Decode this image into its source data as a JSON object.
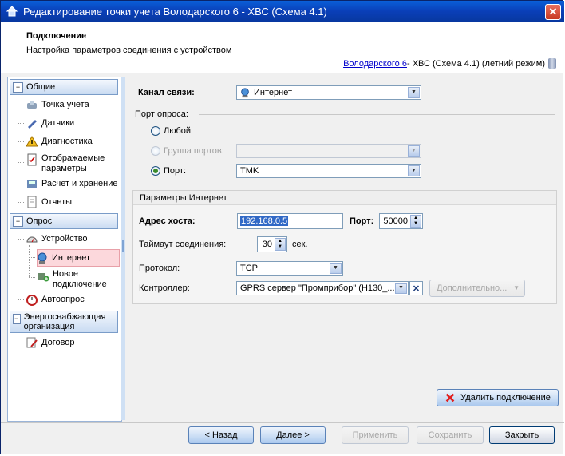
{
  "window": {
    "title": "Редактирование точки учета Володарского 6 - ХВС (Схема 4.1)",
    "close_glyph": "✕"
  },
  "header": {
    "title": "Подключение",
    "subtitle": "Настройка параметров соединения с устройством",
    "path_link": "Володарского 6",
    "path_rest": " - ХВС (Схема 4.1) (летний режим)"
  },
  "nav": {
    "groups": {
      "general": "Общие",
      "poll": "Опрос",
      "energy": "Энергоснабжающая организация"
    },
    "items": {
      "point": "Точка учета",
      "sensors": "Датчики",
      "diagnostics": "Диагностика",
      "displayed_params": "Отображаемые параметры",
      "calc_storage": "Расчет и хранение",
      "reports": "Отчеты",
      "device": "Устройство",
      "internet": "Интернет",
      "new_connection": "Новое подключение",
      "autopoll": "Автоопрос",
      "contract": "Договор"
    }
  },
  "form": {
    "channel_label": "Канал связи:",
    "channel_value": "Интернет",
    "poll_port_label": "Порт опроса:",
    "radio_any": "Любой",
    "radio_group": "Группа портов:",
    "radio_port": "Порт:",
    "port_value": "TMK",
    "panel_title": "Параметры Интернет",
    "host_label": "Адрес хоста:",
    "host_value": "192.168.0.5",
    "port_label": "Порт:",
    "port_num": "50000",
    "timeout_label": "Таймаут соединения:",
    "timeout_value": "30",
    "timeout_unit": "сек.",
    "protocol_label": "Протокол:",
    "protocol_value": "TCP",
    "controller_label": "Контроллер:",
    "controller_value": "GPRS сервер \"Промприбор\" (H130_...",
    "additional_button": "Дополнительно...",
    "delete_button": "Удалить подключение"
  },
  "footer": {
    "back": "< Назад",
    "next": "Далее >",
    "apply": "Применить",
    "save": "Сохранить",
    "close": "Закрыть"
  },
  "colors": {
    "titlebar": "#0a46c0",
    "selected_nav": "#fcd8dc",
    "link": "#0000cc"
  }
}
